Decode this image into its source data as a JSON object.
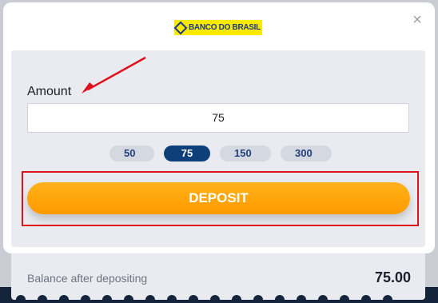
{
  "modal": {
    "close_label": "×",
    "close_icon": "close-icon",
    "logo": {
      "text": "BANCO DO BRASIL",
      "icon": "bank-logo-mark",
      "brand_color": "#fbe900",
      "text_color": "#1b3a8c"
    }
  },
  "form": {
    "amount_label": "Amount",
    "amount_value": "75",
    "quick_amounts": [
      "50",
      "75",
      "150",
      "300"
    ],
    "selected_amount": "75",
    "deposit_label": "DEPOSIT",
    "accent_color": "#ff9a00",
    "highlight_color": "#e0101c"
  },
  "summary": {
    "balance_label": "Balance after depositing",
    "balance_value": "75.00"
  }
}
